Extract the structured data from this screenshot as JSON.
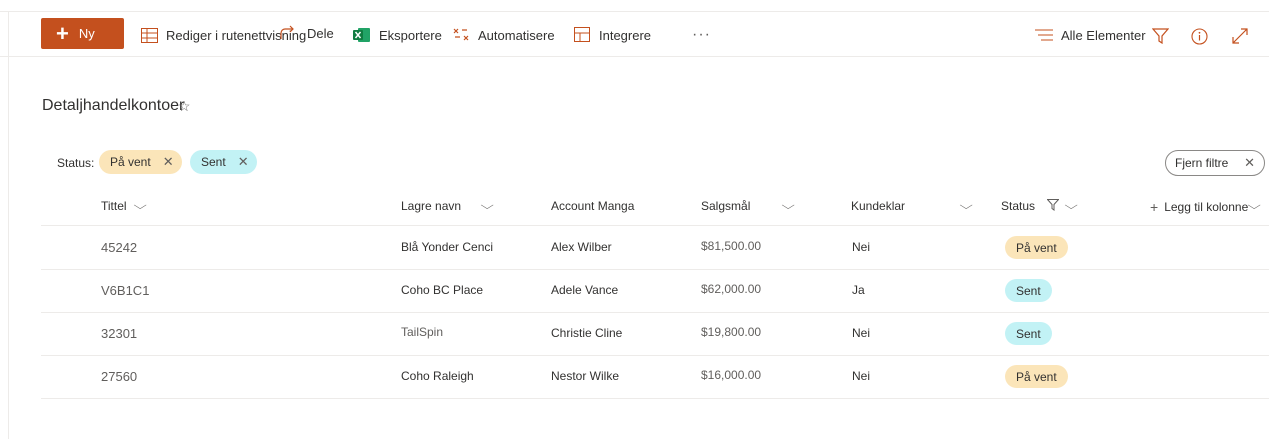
{
  "toolbar": {
    "new_label": "Ny",
    "grid_edit_label": "Rediger i rutenettvisning",
    "share_label": "Dele",
    "export_label": "Eksportere",
    "automate_label": "Automatisere",
    "integrate_label": "Integrere",
    "more_label": "···",
    "view_label": "Alle Elementer"
  },
  "list": {
    "title": "Detaljhandelkontoer",
    "favorite_icon": "☆"
  },
  "filters": {
    "label": "Status:",
    "pills": [
      "På vent",
      "Sent"
    ],
    "clear_label": "Fjern filtre"
  },
  "columns": {
    "title": "Tittel",
    "store_name": "Lagre navn",
    "account_manager": "Account Manga",
    "sales_goal": "Salgsmål",
    "customer_ready": "Kundeklar",
    "status": "Status",
    "add_column": "Legg til kolonne"
  },
  "rows": [
    {
      "title": "45242",
      "store": "Blå Yonder Cenci",
      "manager": "Alex Wilber",
      "goal": "$81,500.00",
      "ready": "Nei",
      "status": "På vent",
      "status_type": "pending"
    },
    {
      "title": "V6B1C1",
      "store": "Coho BC Place",
      "manager": "Adele Vance",
      "goal": "$62,000.00",
      "ready": "Ja",
      "status": "Sent",
      "status_type": "sent"
    },
    {
      "title": "32301",
      "store": "TailSpin",
      "manager": "Christie Cline",
      "goal": "$19,800.00",
      "ready": "Nei",
      "status": "Sent",
      "status_type": "sent"
    },
    {
      "title": "27560",
      "store": "Coho Raleigh",
      "manager": "Nestor Wilke",
      "goal": "$16,000.00",
      "ready": "Nei",
      "status": "På vent",
      "status_type": "pending"
    }
  ],
  "colors": {
    "accent": "#c4501e",
    "pending": "#fbe5b9",
    "sent": "#c2f2f5"
  }
}
